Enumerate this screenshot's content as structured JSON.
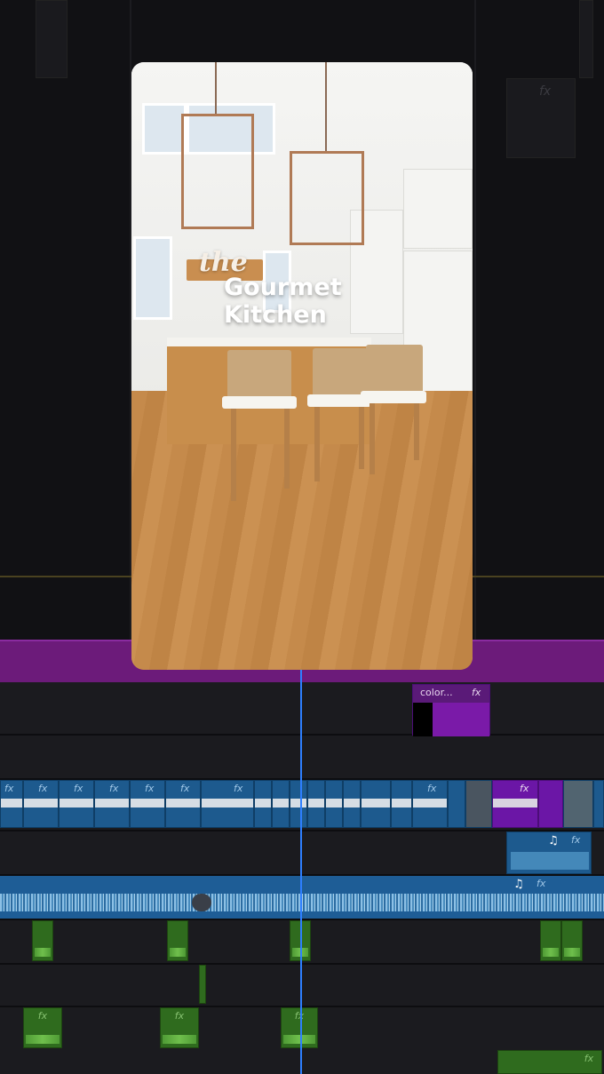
{
  "preview": {
    "title_script": "the",
    "title_line1": "Gourmet",
    "title_line2": "Kitchen"
  },
  "timeline": {
    "color_clip_label": "color...",
    "fx_label": "fx",
    "music_icon": "music-note-icon",
    "music_glyph": "♫"
  },
  "colors": {
    "accent_purple": "#6c1b7a",
    "clip_blue": "#1d5a8e",
    "clip_green": "#2f6b1e",
    "playhead": "#2e7fff"
  }
}
